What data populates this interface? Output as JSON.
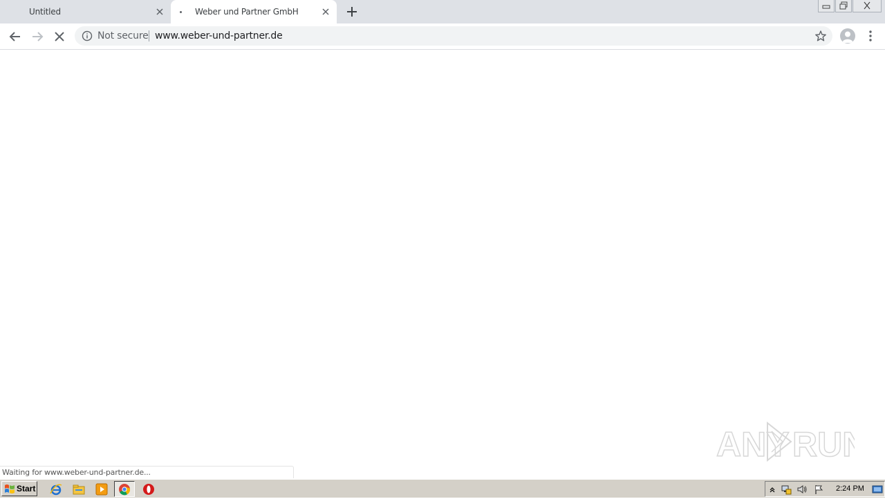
{
  "tabs": [
    {
      "title": "Untitled",
      "active": false
    },
    {
      "title": "Weber und Partner GmbH",
      "active": true
    }
  ],
  "toolbar": {
    "security_label": "Not secure",
    "url": "www.weber-und-partner.de"
  },
  "status": {
    "text": "Waiting for www.weber-und-partner.de..."
  },
  "watermark": {
    "text_left": "ANY",
    "text_right": "RUN"
  },
  "taskbar": {
    "start_label": "Start",
    "clock": "2:24 PM",
    "pinned_icons": [
      "internet-explorer-icon",
      "windows-explorer-icon",
      "media-player-icon",
      "chrome-icon",
      "opera-icon"
    ]
  },
  "colors": {
    "tabstrip": "#dee1e6",
    "omnibox": "#f1f3f4",
    "taskbar": "#d4d0c8"
  }
}
